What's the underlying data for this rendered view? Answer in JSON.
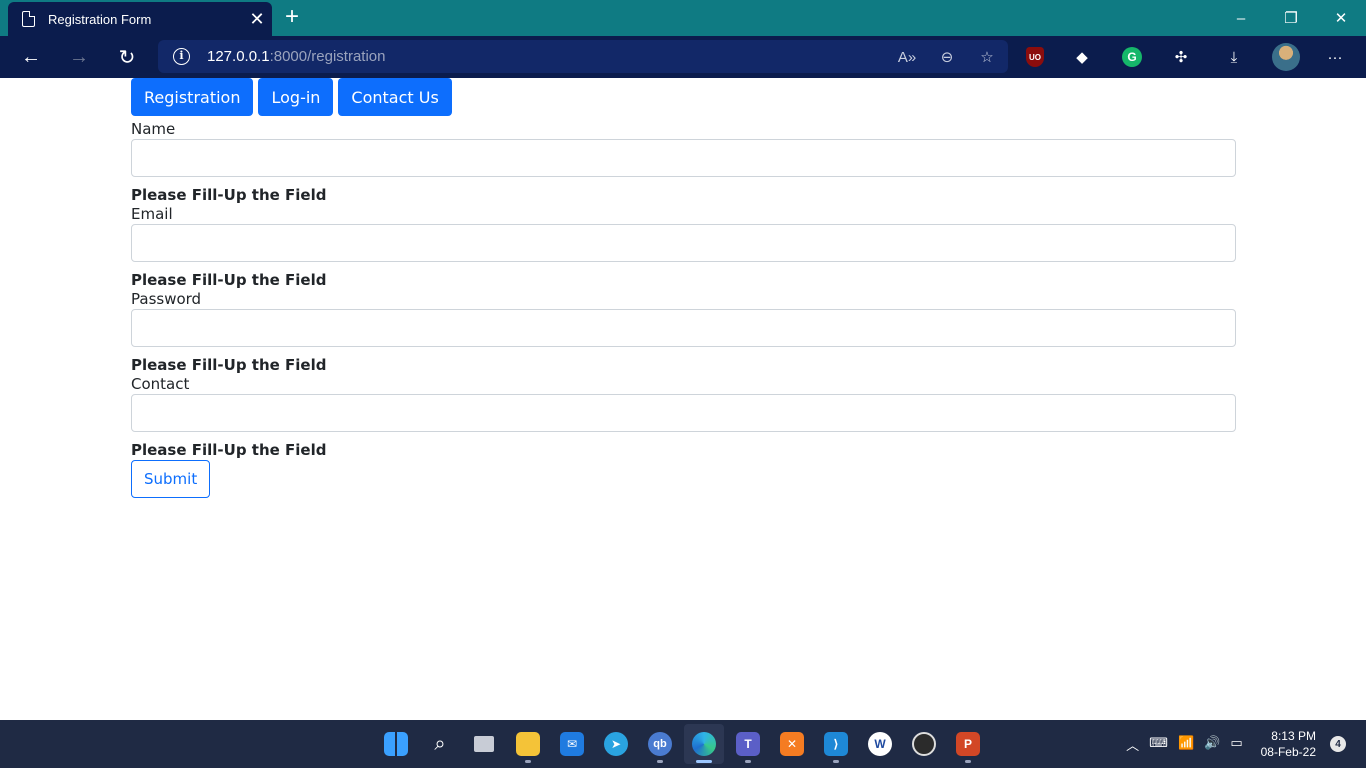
{
  "browser": {
    "tab_title": "Registration Form",
    "tab_close": "✕",
    "new_tab": "+",
    "url_host": "127.0.0.1",
    "url_path": ":8000/registration",
    "window_controls": [
      "–",
      "❐",
      "✕"
    ],
    "extensions": [
      "uBlock Origin",
      "extension",
      "Grammarly",
      "extensions",
      "downloads",
      "profile",
      "more"
    ]
  },
  "page": {
    "nav": [
      "Registration",
      "Log-in",
      "Contact Us"
    ],
    "fields": [
      {
        "label": "Name",
        "value": "",
        "error": "Please Fill-Up the Field"
      },
      {
        "label": "Email",
        "value": "",
        "error": "Please Fill-Up the Field"
      },
      {
        "label": "Password",
        "value": "",
        "error": "Please Fill-Up the Field"
      },
      {
        "label": "Contact",
        "value": "",
        "error": "Please Fill-Up the Field"
      }
    ],
    "submit_label": "Submit"
  },
  "taskbar": {
    "apps": [
      "start",
      "search",
      "task-view",
      "file-explorer",
      "mail",
      "telegram",
      "qbittorrent",
      "edge",
      "teams",
      "xampp",
      "vscode",
      "app",
      "obs",
      "powerpoint"
    ],
    "time": "8:13 PM",
    "date": "08-Feb-22",
    "notifications": "4"
  },
  "colors": {
    "accent": "#0d6efd",
    "tabbar": "#0f7b83",
    "navbar": "#0b1c4d",
    "taskbar": "#1f2a44"
  }
}
